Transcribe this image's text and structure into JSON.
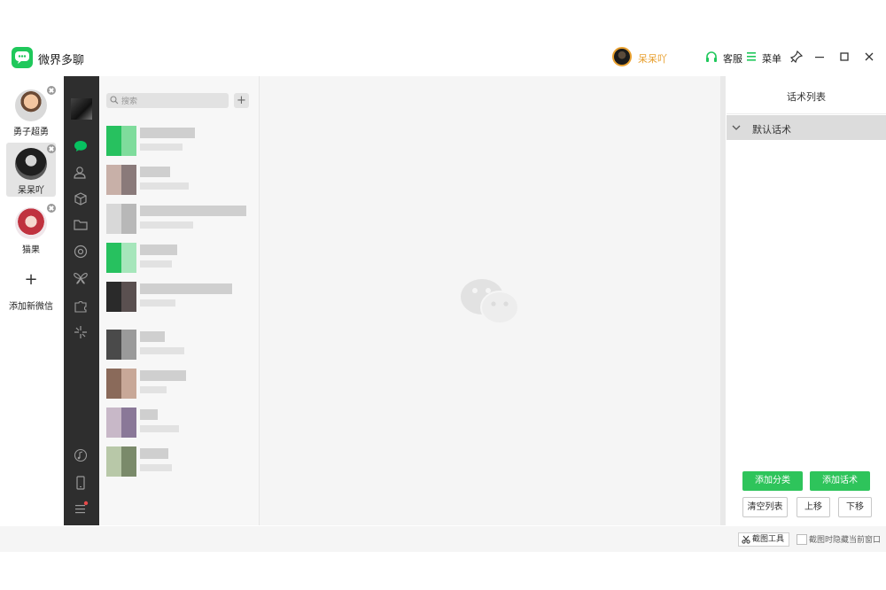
{
  "app": {
    "title": "微界多聊"
  },
  "user": {
    "name": "呆呆吖"
  },
  "toolbar": {
    "service_label": "客服",
    "menu_label": "菜单"
  },
  "accounts": [
    {
      "name": "勇子超勇",
      "selected": false
    },
    {
      "name": "呆呆吖",
      "selected": true
    },
    {
      "name": "猫果",
      "selected": false
    }
  ],
  "add_account": {
    "plus": "+",
    "label": "添加新微信"
  },
  "search": {
    "placeholder": "搜索"
  },
  "add_chat": {
    "label": "+"
  },
  "script_panel": {
    "title": "话术列表",
    "category": "默认话术",
    "buttons": {
      "add_category": "添加分类",
      "add_script": "添加话术",
      "clear_list": "清空列表",
      "move_up": "上移",
      "move_down": "下移"
    }
  },
  "bottom": {
    "capture_label": "截图工具",
    "hide_label": "截图时隐藏当前窗口",
    "hide_checked": false
  },
  "colors": {
    "brand": "#1fc85b",
    "accent": "#e8a030",
    "sidebar": "#2e2e2e"
  },
  "icons": [
    "chat-bubble-icon",
    "contacts-icon",
    "cube-icon",
    "folder-icon",
    "aperture-icon",
    "butterfly-icon",
    "puzzle-icon",
    "sparkle-icon",
    "music-icon",
    "phone-icon",
    "hamburger-icon"
  ]
}
